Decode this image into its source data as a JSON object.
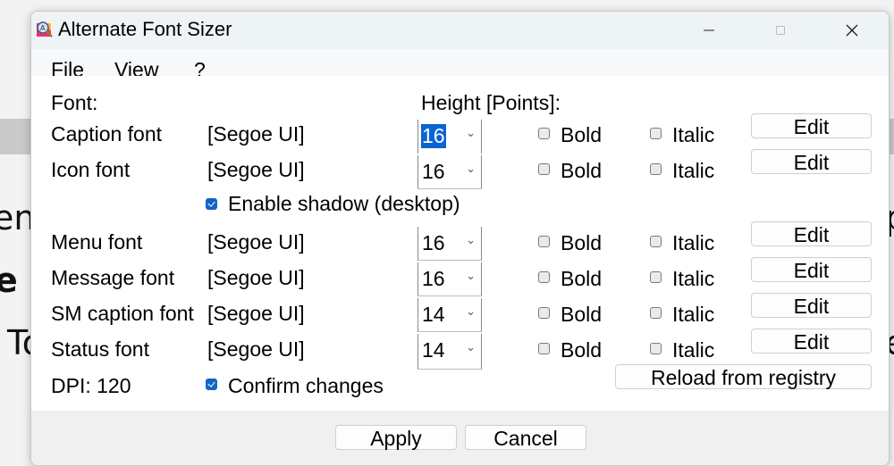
{
  "background": {
    "fragments": [
      "en",
      "e I",
      "To",
      "p",
      "e"
    ]
  },
  "window": {
    "title": "Alternate Font Sizer",
    "icon": "font-sizer-app-icon",
    "controls": {
      "minimize": "minimize-icon",
      "maximize": "maximize-icon",
      "close": "close-icon"
    }
  },
  "menu": {
    "items": [
      "File",
      "View",
      "?"
    ]
  },
  "headers": {
    "font": "Font:",
    "height": "Height [Points]:"
  },
  "fonts": [
    {
      "label": "Caption font",
      "face": "[Segoe UI]",
      "size": "16",
      "size_selected": true,
      "bold_label": "Bold",
      "bold": false,
      "italic_label": "Italic",
      "italic": false,
      "edit_label": "Edit"
    },
    {
      "label": "Icon font",
      "face": "[Segoe UI]",
      "size": "16",
      "size_selected": false,
      "bold_label": "Bold",
      "bold": false,
      "italic_label": "Italic",
      "italic": false,
      "edit_label": "Edit"
    },
    {
      "label": "Menu font",
      "face": "[Segoe UI]",
      "size": "16",
      "size_selected": false,
      "bold_label": "Bold",
      "bold": false,
      "italic_label": "Italic",
      "italic": false,
      "edit_label": "Edit"
    },
    {
      "label": "Message font",
      "face": "[Segoe UI]",
      "size": "16",
      "size_selected": false,
      "bold_label": "Bold",
      "bold": false,
      "italic_label": "Italic",
      "italic": false,
      "edit_label": "Edit"
    },
    {
      "label": "SM caption font",
      "face": "[Segoe UI]",
      "size": "14",
      "size_selected": false,
      "bold_label": "Bold",
      "bold": false,
      "italic_label": "Italic",
      "italic": false,
      "edit_label": "Edit"
    },
    {
      "label": "Status font",
      "face": "[Segoe UI]",
      "size": "14",
      "size_selected": false,
      "bold_label": "Bold",
      "bold": false,
      "italic_label": "Italic",
      "italic": false,
      "edit_label": "Edit"
    }
  ],
  "enable_shadow": {
    "label": "Enable shadow (desktop)",
    "checked": true
  },
  "dpi": "DPI: 120",
  "confirm_changes": {
    "label": "Confirm changes",
    "checked": true
  },
  "reload_label": "Reload from registry",
  "footer": {
    "apply_label": "Apply",
    "cancel_label": "Cancel"
  },
  "colors": {
    "accent": "#0a64d2",
    "checkbox_on": "#1264c8",
    "titlebar": "#eef3f6",
    "footer": "#f0f0f0"
  }
}
